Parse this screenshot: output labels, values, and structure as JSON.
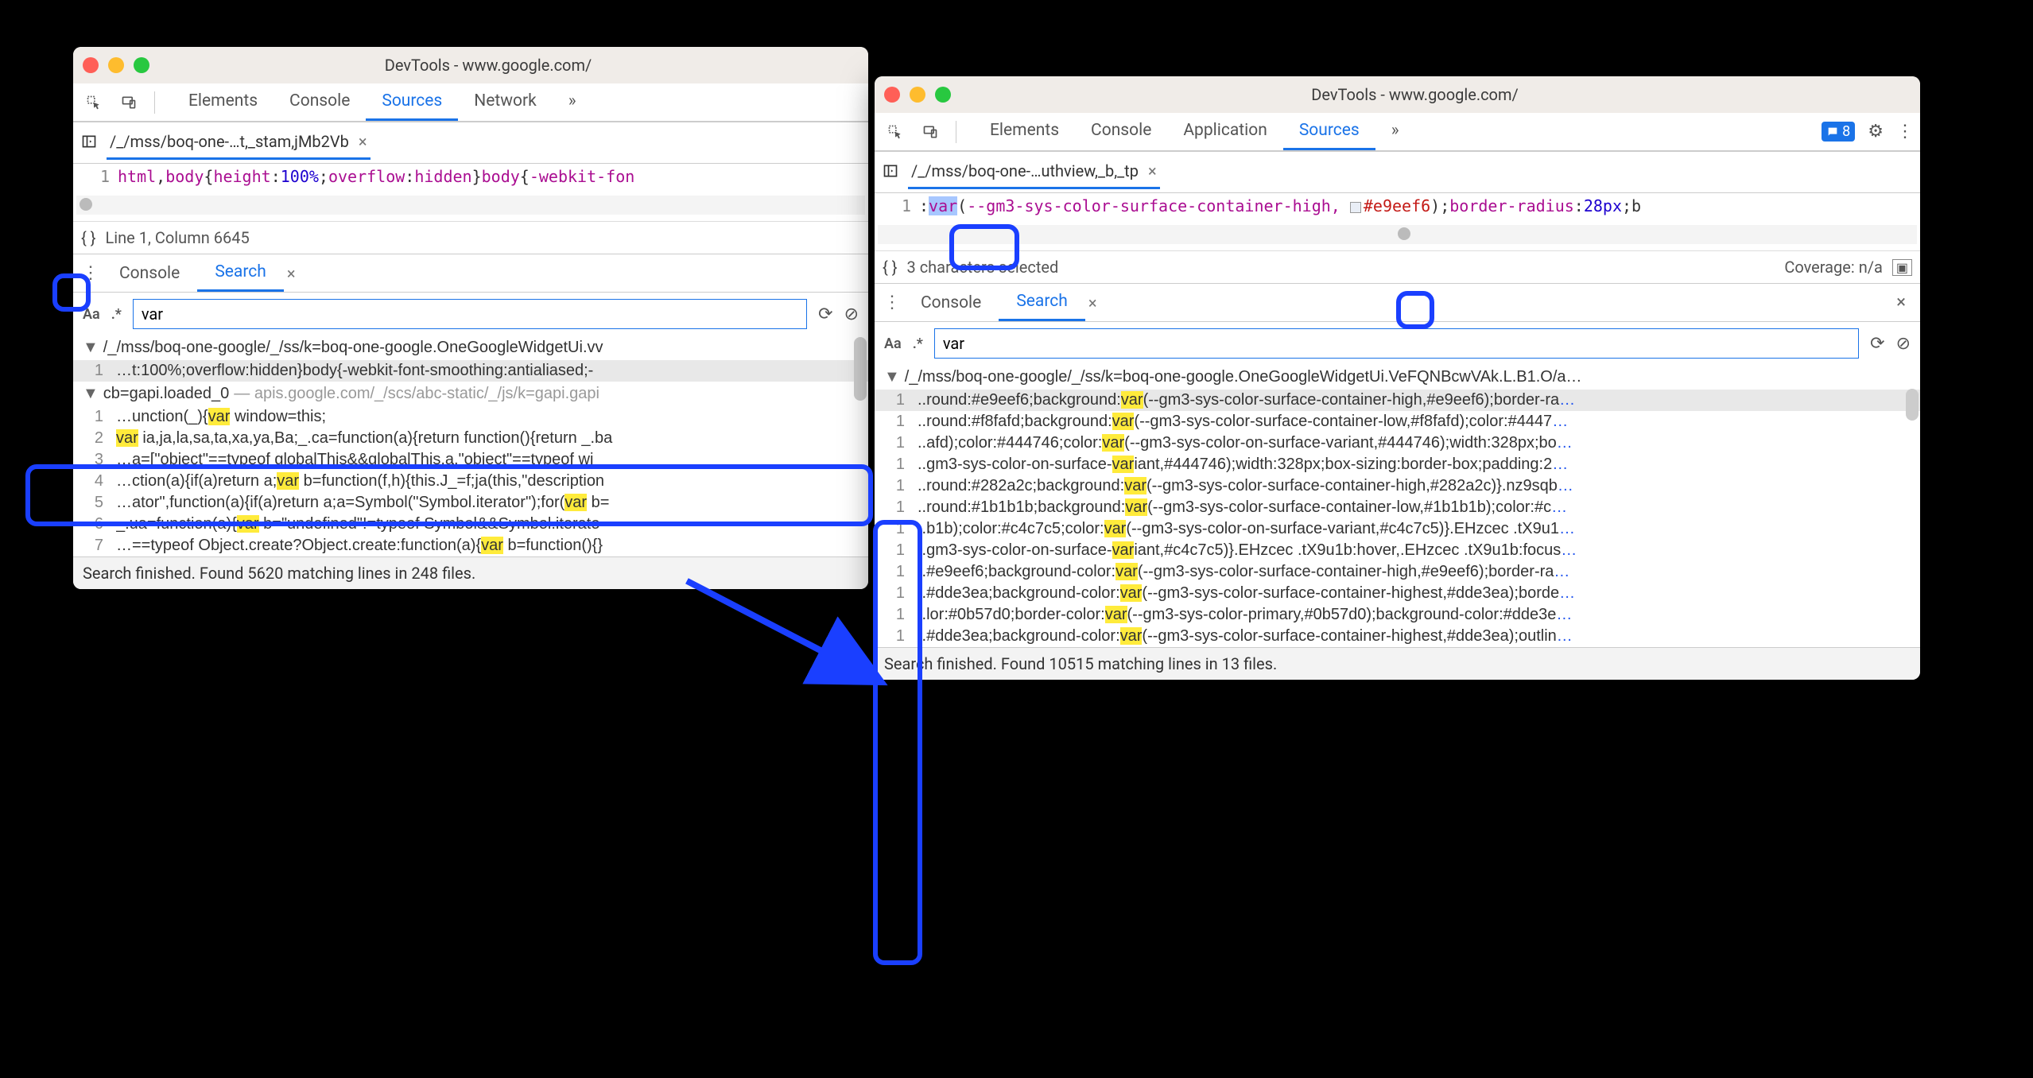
{
  "windows": {
    "left": {
      "title": "DevTools - www.google.com/",
      "panels": [
        "Elements",
        "Console",
        "Sources",
        "Network"
      ],
      "activePanel": "Sources",
      "moreTabs": "»",
      "file": {
        "path": "/_/mss/boq-one-…t,_stam,jMb2Vb",
        "close": "×"
      },
      "code": {
        "line_no": "1",
        "segments": [
          {
            "t": "html",
            "c": "c1"
          },
          {
            "t": ",",
            "c": ""
          },
          {
            "t": "body",
            "c": "c1"
          },
          {
            "t": "{",
            "c": ""
          },
          {
            "t": "height",
            "c": "c1"
          },
          {
            "t": ":",
            "c": ""
          },
          {
            "t": "100%",
            "c": "c2"
          },
          {
            "t": ";",
            "c": ""
          },
          {
            "t": "overflow",
            "c": "c1"
          },
          {
            "t": ":",
            "c": ""
          },
          {
            "t": "hidden",
            "c": "c1"
          },
          {
            "t": "}",
            "c": ""
          },
          {
            "t": "body",
            "c": "c1"
          },
          {
            "t": "{",
            "c": ""
          },
          {
            "t": "-webkit-fon",
            "c": "c1"
          }
        ]
      },
      "status": "Line 1, Column 6645",
      "drawerTabs": [
        "Console",
        "Search"
      ],
      "drawerActive": "Search",
      "search": {
        "placeholder": "",
        "value": "var",
        "matchCase": "Aa",
        "regex": ".*"
      },
      "results": [
        {
          "type": "file",
          "arrow": "▼",
          "text": "/_/mss/boq-one-google/_/ss/k=boq-one-google.OneGoogleWidgetUi.vv"
        },
        {
          "type": "row",
          "n": "1",
          "selected": true,
          "segs": [
            {
              "t": "…t:100%;overflow:hidden}body{-webkit-font-smoothing:antialiased;-"
            }
          ]
        },
        {
          "type": "file",
          "arrow": "▼",
          "text": "cb=gapi.loaded_0",
          "sub": " — apis.google.com/_/scs/abc-static/_/js/k=gapi.gapi"
        },
        {
          "type": "row",
          "n": "1",
          "segs": [
            {
              "t": "…unction(_){"
            },
            {
              "t": "var",
              "hl": true
            },
            {
              "t": " window=this;"
            }
          ]
        },
        {
          "type": "row",
          "n": "2",
          "segs": [
            {
              "t": "var",
              "hl": true
            },
            {
              "t": " ia,ja,la,sa,ta,xa,ya,Ba;_.ca=function(a){return function(){return _.ba"
            }
          ]
        },
        {
          "type": "row",
          "n": "3",
          "segs": [
            {
              "t": "…a=[\"object\"==typeof globalThis&&globalThis,a,\"object\"==typeof wi"
            }
          ]
        },
        {
          "type": "row",
          "n": "4",
          "segs": [
            {
              "t": "…ction(a){if(a)return a;"
            },
            {
              "t": "var",
              "hl": true
            },
            {
              "t": " b=function(f,h){this.J_=f;ja(this,\"description"
            }
          ]
        },
        {
          "type": "row",
          "n": "5",
          "segs": [
            {
              "t": "…ator\",function(a){if(a)return a;a=Symbol(\"Symbol.iterator\");for("
            },
            {
              "t": "var",
              "hl": true
            },
            {
              "t": " b="
            }
          ]
        },
        {
          "type": "row",
          "n": "6",
          "segs": [
            {
              "t": "_.ua=function(a){"
            },
            {
              "t": "var",
              "hl": true
            },
            {
              "t": " b=\"undefined\"!=typeof Symbol&&Symbol.iterato"
            }
          ]
        },
        {
          "type": "row",
          "n": "7",
          "segs": [
            {
              "t": "…==typeof Object.create?Object.create:function(a){"
            },
            {
              "t": "var",
              "hl": true
            },
            {
              "t": " b=function(){}"
            }
          ]
        }
      ],
      "footer": "Search finished.  Found 5620 matching lines in 248 files."
    },
    "right": {
      "title": "DevTools - www.google.com/",
      "panels": [
        "Elements",
        "Console",
        "Application",
        "Sources"
      ],
      "activePanel": "Sources",
      "moreTabs": "»",
      "msgCount": "8",
      "file": {
        "path": "/_/mss/boq-one-…uthview,_b,_tp",
        "close": "×"
      },
      "code": {
        "line_no": "1",
        "pre": ":",
        "sel": "var",
        "post_pre": "(",
        "post_rest": "--gm3-sys-color-surface-container-high, ",
        "hex": "#e9eef6",
        "after": ");",
        "br": "border-radius",
        "colon": ":",
        "px": "28px",
        "semib": ";b"
      },
      "status": "3 characters selected",
      "coverage": "Coverage: n/a",
      "drawerTabs": [
        "Console",
        "Search"
      ],
      "drawerActive": "Search",
      "search": {
        "value": "var",
        "matchCase": "Aa",
        "regex": ".*"
      },
      "resultsHeader": {
        "arrow": "▼",
        "text": "/_/mss/boq-one-google/_/ss/k=boq-one-google.OneGoogleWidgetUi.VeFQNBcwVAk.L.B1.O/a…"
      },
      "results": [
        {
          "n": "1",
          "sel": true,
          "segs": [
            {
              "t": "..round:#e9eef6;background:"
            },
            {
              "t": "var",
              "hl": true
            },
            {
              "t": "(--gm3-sys-color-surface-container-high,#e9eef6);border-ra"
            },
            {
              "t": "…",
              "blue": true
            }
          ]
        },
        {
          "n": "1",
          "segs": [
            {
              "t": "..round:#f8fafd;background:"
            },
            {
              "t": "var",
              "hl": true
            },
            {
              "t": "(--gm3-sys-color-surface-container-low,#f8fafd);color:#4447"
            },
            {
              "t": "…",
              "blue": true
            }
          ]
        },
        {
          "n": "1",
          "segs": [
            {
              "t": "..afd);color:#444746;color:"
            },
            {
              "t": "var",
              "hl": true
            },
            {
              "t": "(--gm3-sys-color-on-surface-variant,#444746);width:328px;bo"
            },
            {
              "t": "…",
              "blue": true
            }
          ]
        },
        {
          "n": "1",
          "segs": [
            {
              "t": "..gm3-sys-color-on-surface-"
            },
            {
              "t": "var",
              "hl": true
            },
            {
              "t": "iant,#444746);width:328px;box-sizing:border-box;padding:2"
            },
            {
              "t": "…",
              "blue": true
            }
          ]
        },
        {
          "n": "1",
          "segs": [
            {
              "t": "..round:#282a2c;background:"
            },
            {
              "t": "var",
              "hl": true
            },
            {
              "t": "(--gm3-sys-color-surface-container-high,#282a2c)}.nz9sqb"
            },
            {
              "t": "…",
              "blue": true
            }
          ]
        },
        {
          "n": "1",
          "segs": [
            {
              "t": "..round:#1b1b1b;background:"
            },
            {
              "t": "var",
              "hl": true
            },
            {
              "t": "(--gm3-sys-color-surface-container-low,#1b1b1b);color:#c"
            },
            {
              "t": "…",
              "blue": true
            }
          ]
        },
        {
          "n": "1",
          "segs": [
            {
              "t": "..b1b);color:#c4c7c5;color:"
            },
            {
              "t": "var",
              "hl": true
            },
            {
              "t": "(--gm3-sys-color-on-surface-variant,#c4c7c5)}.EHzcec .tX9u1"
            },
            {
              "t": "…",
              "blue": true
            }
          ]
        },
        {
          "n": "1",
          "segs": [
            {
              "t": "..gm3-sys-color-on-surface-"
            },
            {
              "t": "var",
              "hl": true
            },
            {
              "t": "iant,#c4c7c5)}.EHzcec .tX9u1b:hover,.EHzcec .tX9u1b:focus"
            },
            {
              "t": "…",
              "blue": true
            }
          ]
        },
        {
          "n": "1",
          "segs": [
            {
              "t": "..#e9eef6;background-color:"
            },
            {
              "t": "var",
              "hl": true
            },
            {
              "t": "(--gm3-sys-color-surface-container-high,#e9eef6);border-ra"
            },
            {
              "t": "…",
              "blue": true
            }
          ]
        },
        {
          "n": "1",
          "segs": [
            {
              "t": "..#dde3ea;background-color:"
            },
            {
              "t": "var",
              "hl": true
            },
            {
              "t": "(--gm3-sys-color-surface-container-highest,#dde3ea);borde"
            },
            {
              "t": "…",
              "blue": true
            }
          ]
        },
        {
          "n": "1",
          "segs": [
            {
              "t": "..lor:#0b57d0;border-color:"
            },
            {
              "t": "var",
              "hl": true
            },
            {
              "t": "(--gm3-sys-color-primary,#0b57d0);background-color:#dde3e"
            },
            {
              "t": "…",
              "blue": true
            }
          ]
        },
        {
          "n": "1",
          "segs": [
            {
              "t": "..#dde3ea;background-color:"
            },
            {
              "t": "var",
              "hl": true
            },
            {
              "t": "(--gm3-sys-color-surface-container-highest,#dde3ea);outlin"
            },
            {
              "t": "…",
              "blue": true
            }
          ]
        }
      ],
      "footer": "Search finished.  Found 10515 matching lines in 13 files."
    }
  }
}
